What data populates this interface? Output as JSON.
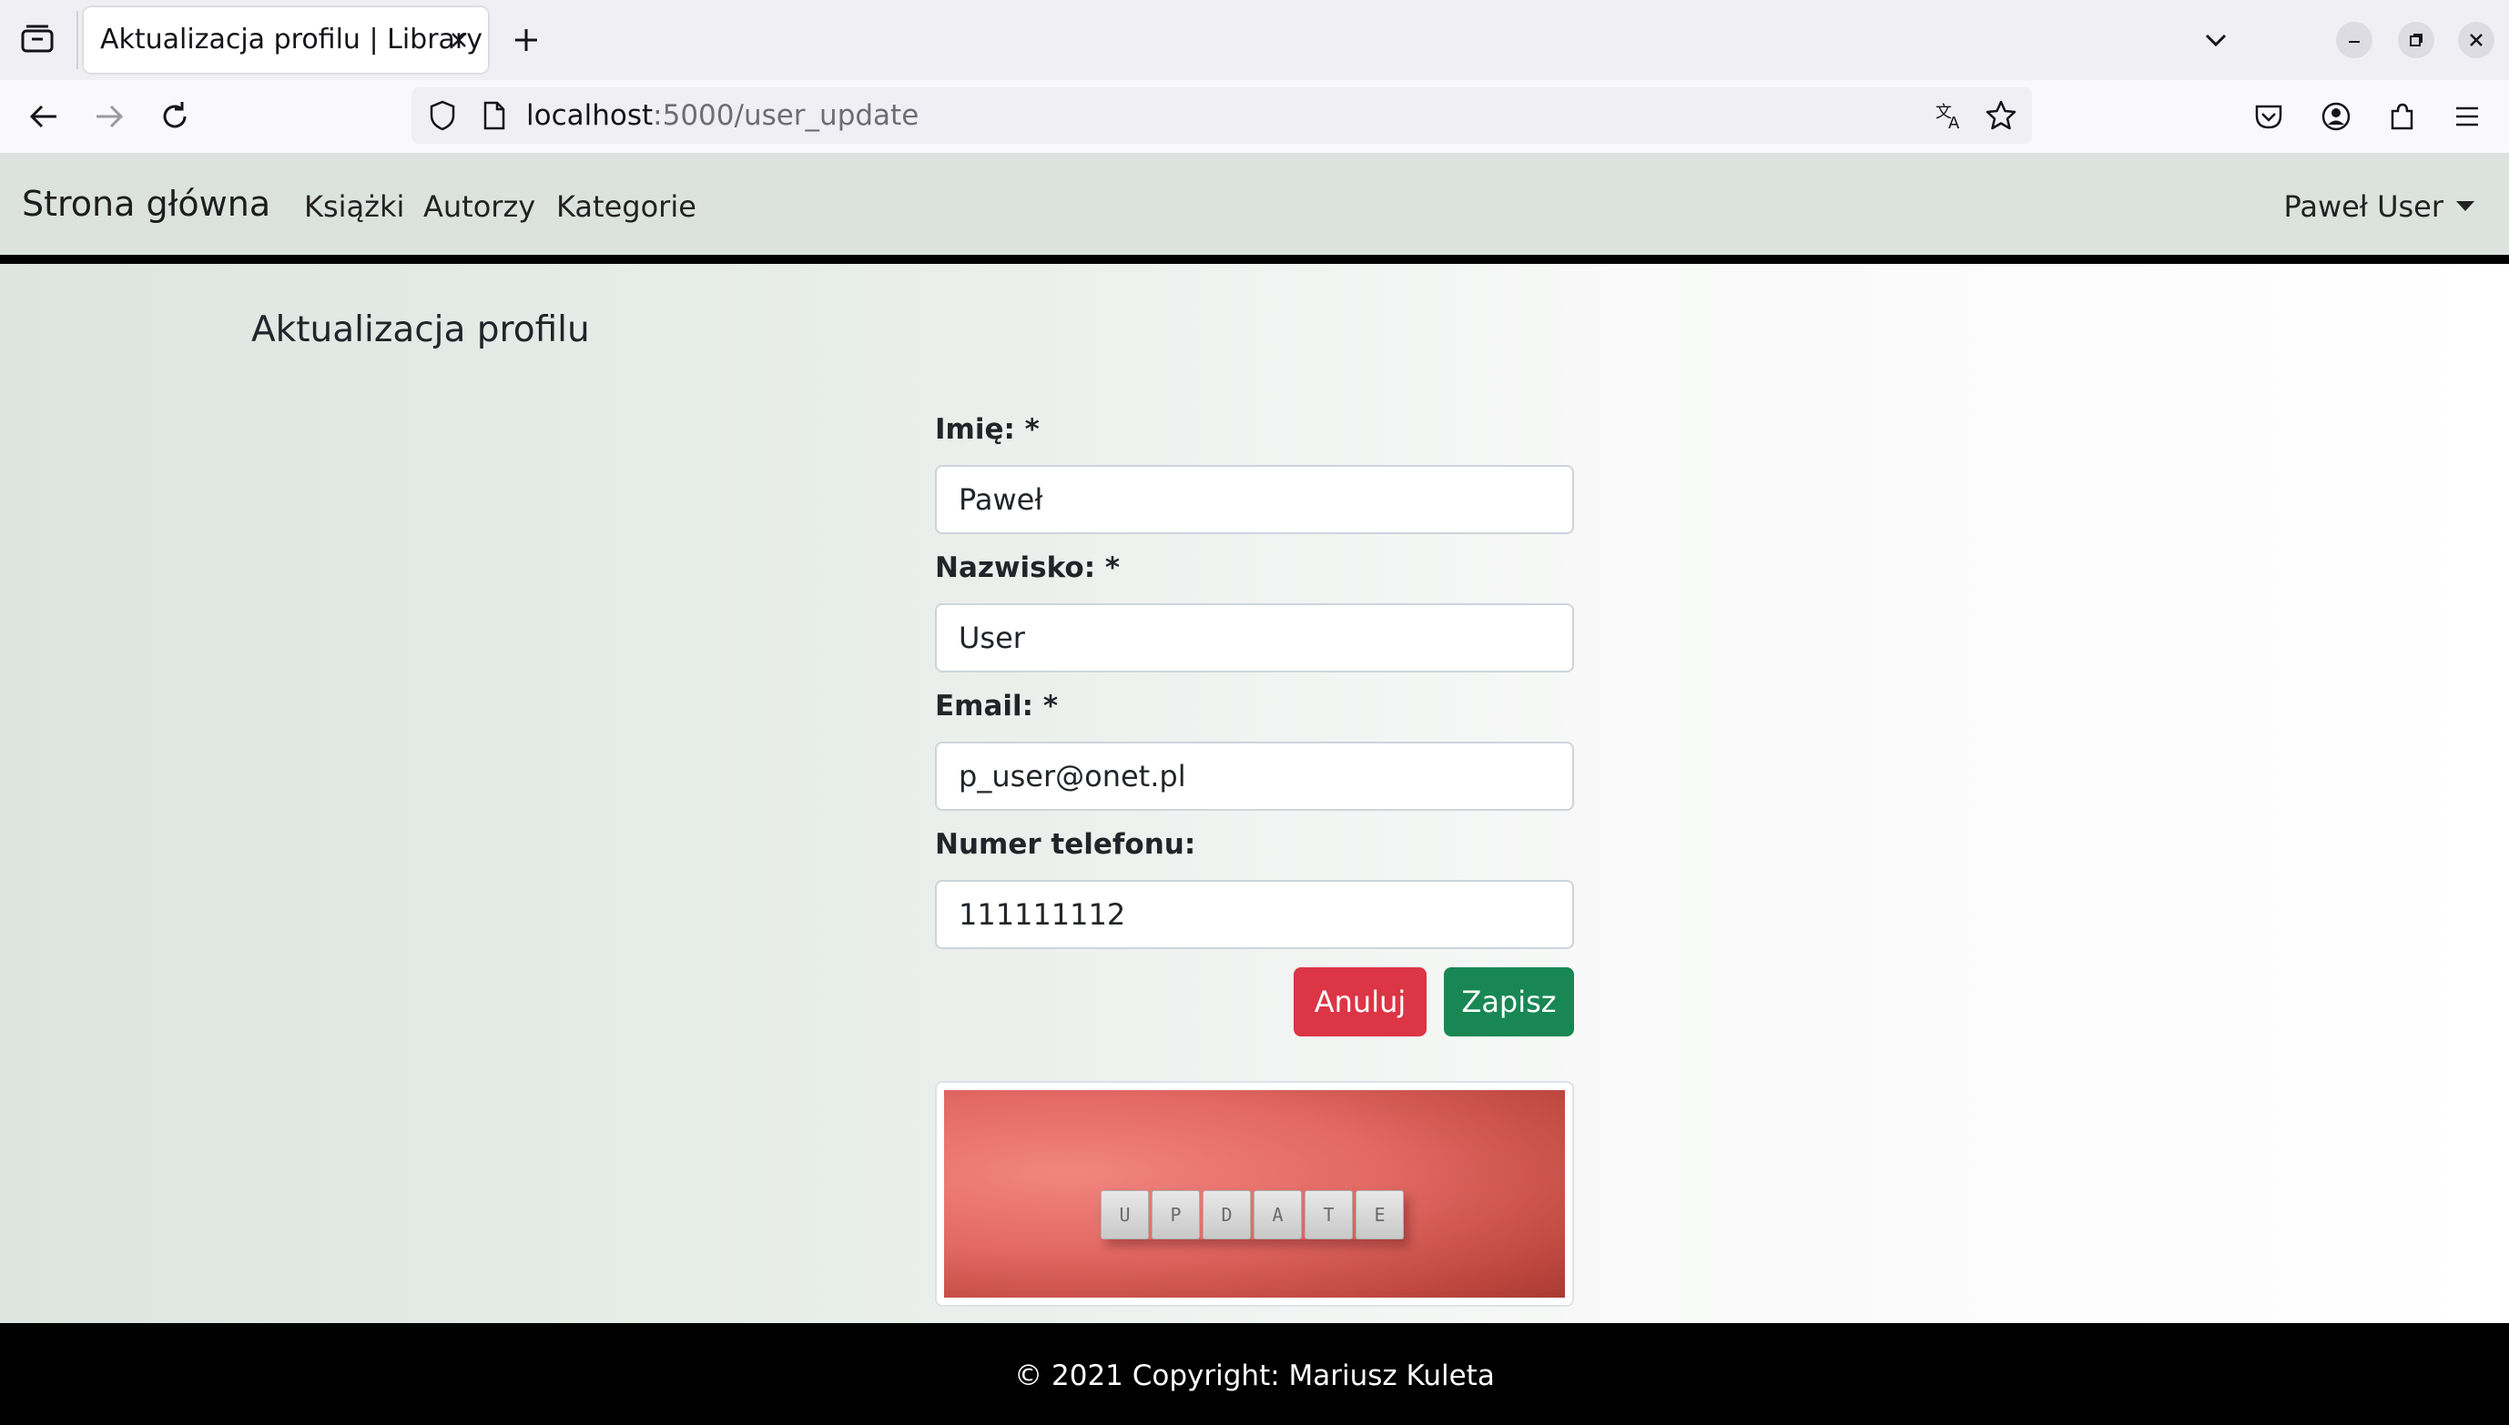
{
  "browser": {
    "tab_title": "Aktualizacja profilu | Library",
    "url_host": "localhost",
    "url_path": ":5000/user_update"
  },
  "site_nav": {
    "brand": "Strona główna",
    "links": [
      "Książki",
      "Autorzy",
      "Kategorie"
    ],
    "user": "Paweł User"
  },
  "page": {
    "title": "Aktualizacja profilu"
  },
  "form": {
    "first_name": {
      "label": "Imię: *",
      "value": "Paweł"
    },
    "last_name": {
      "label": "Nazwisko: *",
      "value": "User"
    },
    "email": {
      "label": "Email: *",
      "value": "p_user@onet.pl"
    },
    "phone": {
      "label": "Numer telefonu:",
      "value": "111111112"
    },
    "cancel_label": "Anuluj",
    "save_label": "Zapisz"
  },
  "image": {
    "tiles": [
      "U",
      "P",
      "D",
      "A",
      "T",
      "E"
    ]
  },
  "footer": {
    "copyright": "© 2021 Copyright: Mariusz Kuleta"
  },
  "colors": {
    "cancel": "#dc3545",
    "save": "#198754",
    "navbar_bg": "#dce3df",
    "footer_bg": "#000000"
  }
}
